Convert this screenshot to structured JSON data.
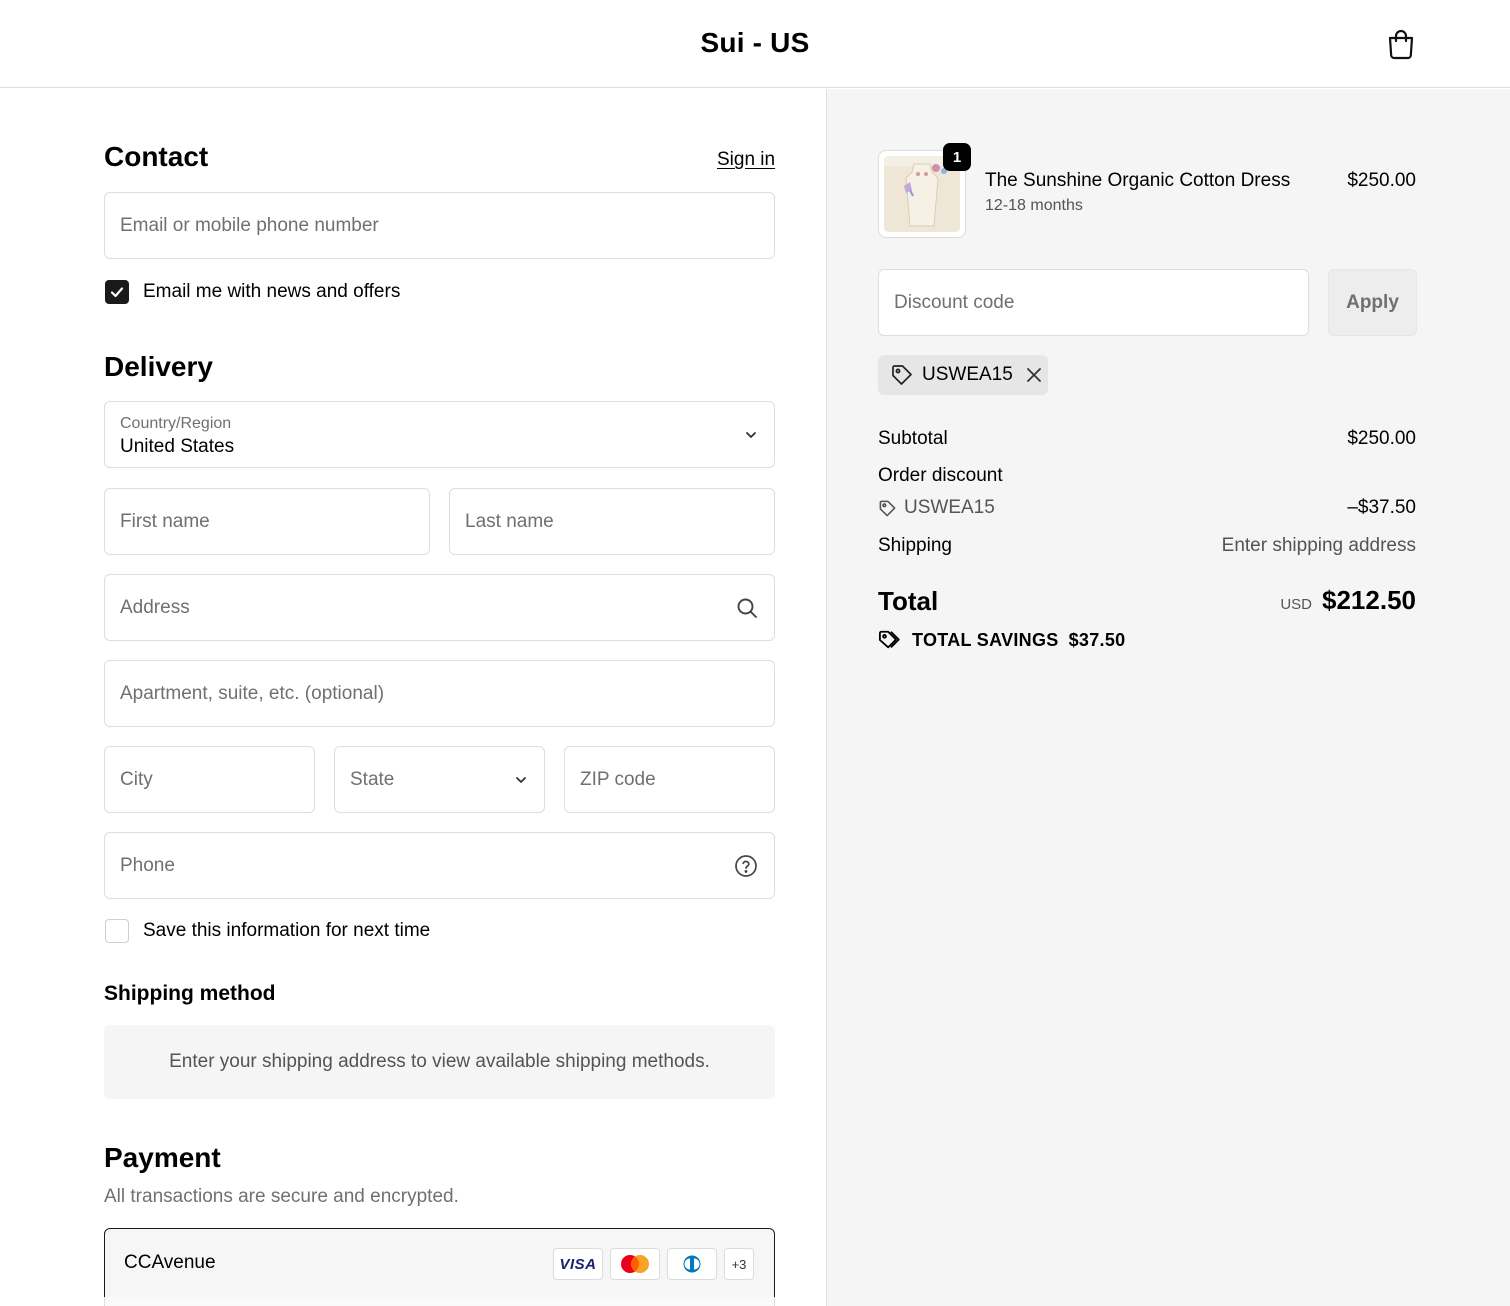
{
  "header": {
    "store_name": "Sui - US",
    "cart_icon": "shopping-bag-icon"
  },
  "contact": {
    "title": "Contact",
    "sign_in": "Sign in",
    "email_placeholder": "Email or mobile phone number",
    "news_label": "Email me with news and offers",
    "news_checked": true
  },
  "delivery": {
    "title": "Delivery",
    "country_label": "Country/Region",
    "country_value": "United States",
    "first_name_placeholder": "First name",
    "last_name_placeholder": "Last name",
    "address_placeholder": "Address",
    "apartment_placeholder": "Apartment, suite, etc. (optional)",
    "city_placeholder": "City",
    "state_placeholder": "State",
    "zip_placeholder": "ZIP code",
    "phone_placeholder": "Phone",
    "save_label": "Save this information for next time",
    "save_checked": false
  },
  "shipping_method": {
    "title": "Shipping method",
    "message": "Enter your shipping address to view available shipping methods."
  },
  "payment": {
    "title": "Payment",
    "subtitle": "All transactions are secure and encrypted.",
    "provider": "CCAvenue",
    "card_visa": "VISA",
    "more_cards": "+3"
  },
  "summary": {
    "item": {
      "quantity": "1",
      "title": "The Sunshine Organic Cotton Dress",
      "variant": "12-18 months",
      "price": "$250.00"
    },
    "discount_placeholder": "Discount code",
    "apply_label": "Apply",
    "applied_code": "USWEA15",
    "subtotal_label": "Subtotal",
    "subtotal_value": "$250.00",
    "order_discount_label": "Order discount",
    "discount_code": "USWEA15",
    "discount_value": "–$37.50",
    "shipping_label": "Shipping",
    "shipping_value": "Enter shipping address",
    "total_label": "Total",
    "total_currency": "USD",
    "total_value": "$212.50",
    "savings_label": "TOTAL SAVINGS",
    "savings_value": "$37.50"
  },
  "colors": {
    "accent": "#1a1a1a",
    "summary_bg": "#f5f5f5",
    "border": "#dedede",
    "muted_text": "#707070"
  }
}
